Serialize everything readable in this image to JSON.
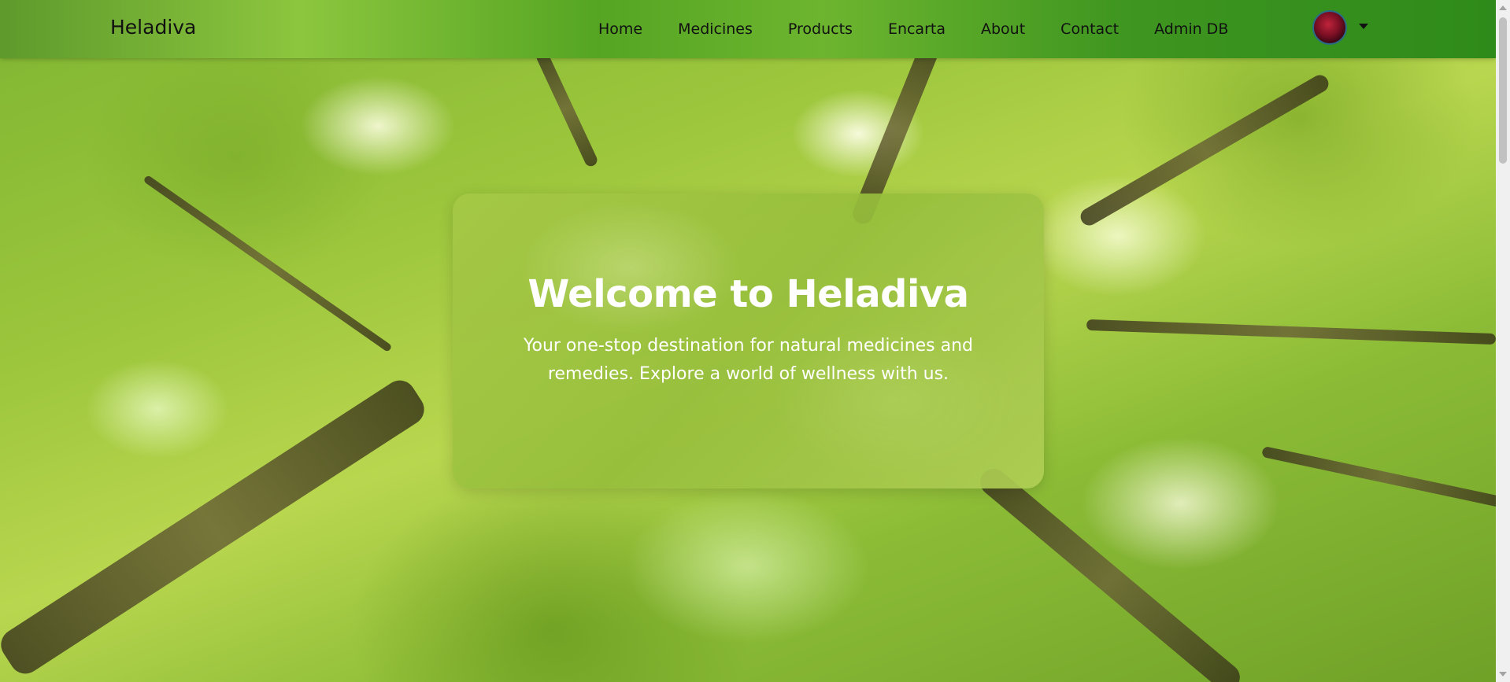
{
  "navbar": {
    "brand": "Heladiva",
    "links": [
      "Home",
      "Medicines",
      "Products",
      "Encarta",
      "About",
      "Contact",
      "Admin DB"
    ],
    "avatar_icon": "user-avatar",
    "dropdown_icon": "caret-down-icon"
  },
  "hero": {
    "title": "Welcome to Heladiva",
    "subtitle": "Your one-stop destination for natural medicines and remedies. Explore a world of wellness with us.",
    "background": "forest-canopy-image"
  },
  "colors": {
    "navbar": "#5fa52c",
    "card": "#a5c846",
    "text_light": "#ffffff",
    "text_dark": "#111111"
  }
}
